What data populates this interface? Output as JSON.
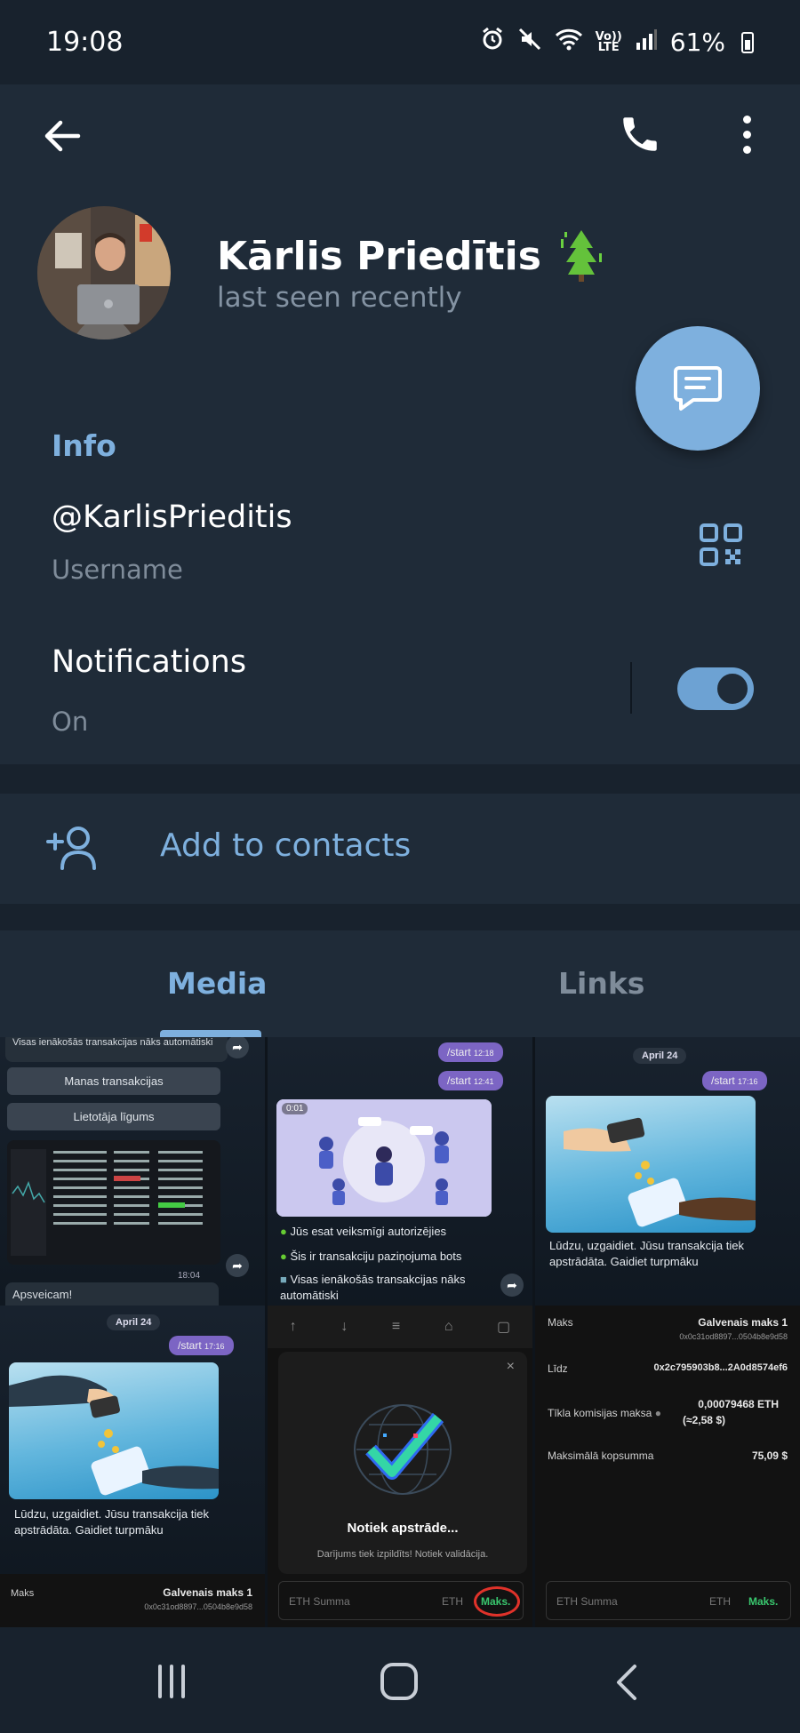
{
  "status_bar": {
    "time": "19:08",
    "battery": "61%",
    "network": "LTE",
    "volte": "Vo))"
  },
  "header": {
    "name": "Kārlis Priedītis",
    "last_seen": "last seen recently",
    "back_icon": "arrow-left-icon",
    "call_icon": "phone-icon",
    "more_icon": "more-vertical-icon",
    "message_icon": "message-icon"
  },
  "info": {
    "section_title": "Info",
    "username": "@KarlisPrieditis",
    "username_label": "Username",
    "notifications_label": "Notifications",
    "notifications_value": "On",
    "notifications_on": true
  },
  "add_contact": {
    "label": "Add to contacts"
  },
  "tabs": [
    {
      "label": "Media",
      "active": true
    },
    {
      "label": "Links",
      "active": false
    }
  ],
  "media": {
    "c1": {
      "top_text": "Visas ienākošās transakcijas nāks automātiski",
      "btn1": "Manas transakcijas",
      "btn2": "Lietotāja līgums",
      "bottom_text": "Apsveicam!",
      "time": "18:04"
    },
    "c2": {
      "start1": "/start",
      "time1": "12:18",
      "start2": "/start",
      "time2": "12:41",
      "video_time": "0:01",
      "line1": "Jūs esat veiksmīgi autorizējies",
      "line2": "Šis ir transakciju paziņojuma bots",
      "line3": "Visas ienākošās transakcijas nāks automātiski"
    },
    "c3": {
      "date": "April 24",
      "start": "/start",
      "time": "17:16",
      "caption": "Lūdzu, uzgaidiet. Jūsu transakcija tiek apstrādāta. Gaidiet turpmāku"
    },
    "c4": {
      "date": "April 24",
      "start": "/start",
      "time": "17:16",
      "caption": "Lūdzu, uzgaidiet. Jūsu transakcija tiek apstrādāta. Gaidiet turpmāku"
    },
    "c5": {
      "title": "Notiek apstrāde...",
      "subtitle": "Darījums tiek izpildīts! Notiek validācija."
    },
    "c6": {
      "maks_label": "Maks",
      "maks_value": "Galvenais maks 1",
      "maks_addr": "0x0c31od8897...0504b8e9d58",
      "lidz_label": "Līdz",
      "lidz_value": "0x2c795903b8...2A0d8574ef6",
      "fee_label": "Tīkla komisijas maksa",
      "fee_value": "0,00079468 ETH",
      "fee_usd": "(≈2,58 $)",
      "max_label": "Maksimālā kopsumma",
      "max_value": "75,09 $"
    },
    "c7": {
      "maks_label": "Maks",
      "maks_value": "Galvenais maks 1",
      "maks_addr": "0x0c31od8897...0504b8e9d58"
    },
    "c8": {
      "input_placeholder": "ETH Summa",
      "unit": "ETH",
      "max_btn": "Maks."
    },
    "c9": {
      "input_placeholder": "ETH Summa",
      "unit": "ETH",
      "max_btn": "Maks."
    }
  },
  "colors": {
    "background": "#18222d",
    "surface": "#1f2b38",
    "accent": "#7eb0de",
    "muted": "#7f8c9a"
  }
}
